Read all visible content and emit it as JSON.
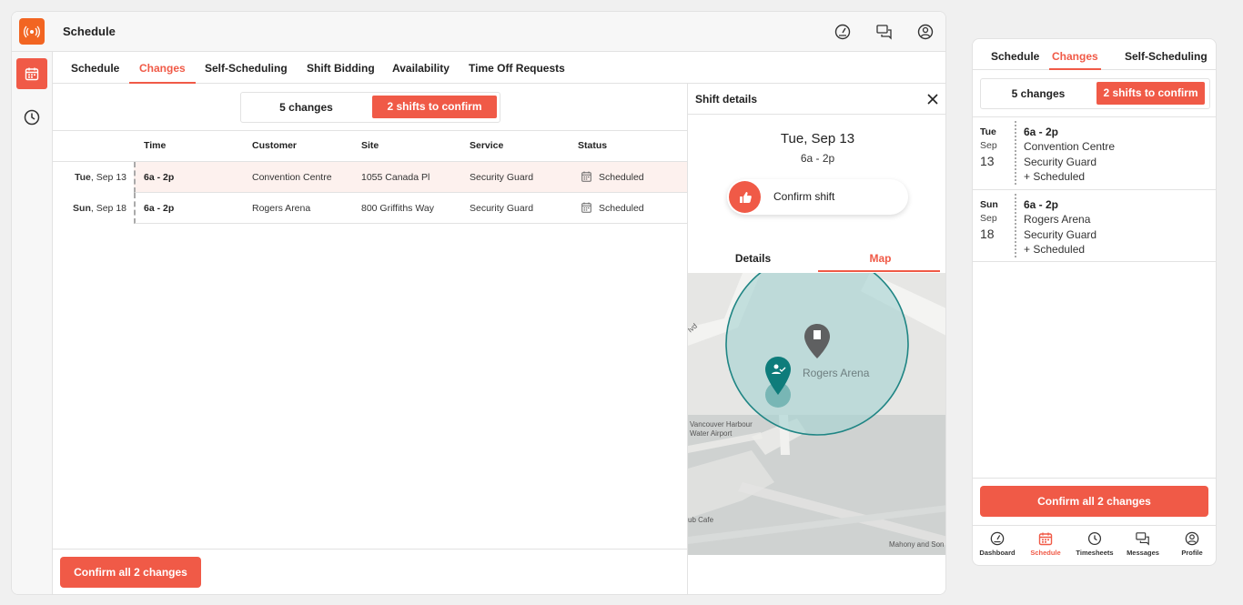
{
  "app": {
    "title": "Schedule"
  },
  "tabs": [
    "Schedule",
    "Changes",
    "Self-Scheduling",
    "Shift Bidding",
    "Availability",
    "Time Off Requests"
  ],
  "segment": {
    "changes": "5 changes",
    "confirm": "2 shifts to confirm"
  },
  "table": {
    "headers": {
      "time": "Time",
      "customer": "Customer",
      "site": "Site",
      "service": "Service",
      "status": "Status"
    },
    "rows": [
      {
        "day": "Tue",
        "date": "Sep 13",
        "time": "6a - 2p",
        "customer": "Convention Centre",
        "site": "1055 Canada Pl",
        "service": "Security Guard",
        "status": "Scheduled"
      },
      {
        "day": "Sun",
        "date": "Sep 18",
        "time": "6a - 2p",
        "customer": "Rogers Arena",
        "site": "800 Griffiths Way",
        "service": "Security Guard",
        "status": "Scheduled"
      }
    ]
  },
  "confirm_all": "Confirm all 2 changes",
  "details": {
    "title": "Shift details",
    "date": "Tue, Sep 13",
    "time": "6a - 2p",
    "confirm": "Confirm shift",
    "tabs": {
      "details": "Details",
      "map": "Map"
    },
    "map_labels": {
      "arena": "Rogers Arena",
      "airport": "Vancouver Harbour\nWater Airport",
      "cafe": "ub Cafe",
      "road": "Mahony and Son",
      "blvd": "lvd"
    }
  },
  "mobile": {
    "tabs": [
      "Schedule",
      "Changes",
      "Self-Scheduling"
    ],
    "segment": {
      "changes": "5 changes",
      "confirm": "2 shifts to confirm"
    },
    "items": [
      {
        "day": "Tue",
        "month": "Sep",
        "num": "13",
        "time": "6a - 2p",
        "customer": "Convention Centre",
        "service": "Security Guard",
        "status": "+ Scheduled"
      },
      {
        "day": "Sun",
        "month": "Sep",
        "num": "18",
        "time": "6a - 2p",
        "customer": "Rogers Arena",
        "service": "Security Guard",
        "status": "+ Scheduled"
      }
    ],
    "confirm_all": "Confirm all 2 changes",
    "nav": [
      "Dashboard",
      "Schedule",
      "Timesheets",
      "Messages",
      "Profile"
    ]
  },
  "colors": {
    "accent": "#f05a47",
    "brand": "#f26522",
    "teal": "#0e7c7b"
  },
  "icons": [
    "logo-icon",
    "speedometer-icon",
    "chat-icon",
    "user-circle-icon",
    "calendar-icon",
    "clock-icon",
    "close-icon",
    "thumbs-up-icon",
    "building-pin-icon",
    "worker-pin-icon"
  ]
}
